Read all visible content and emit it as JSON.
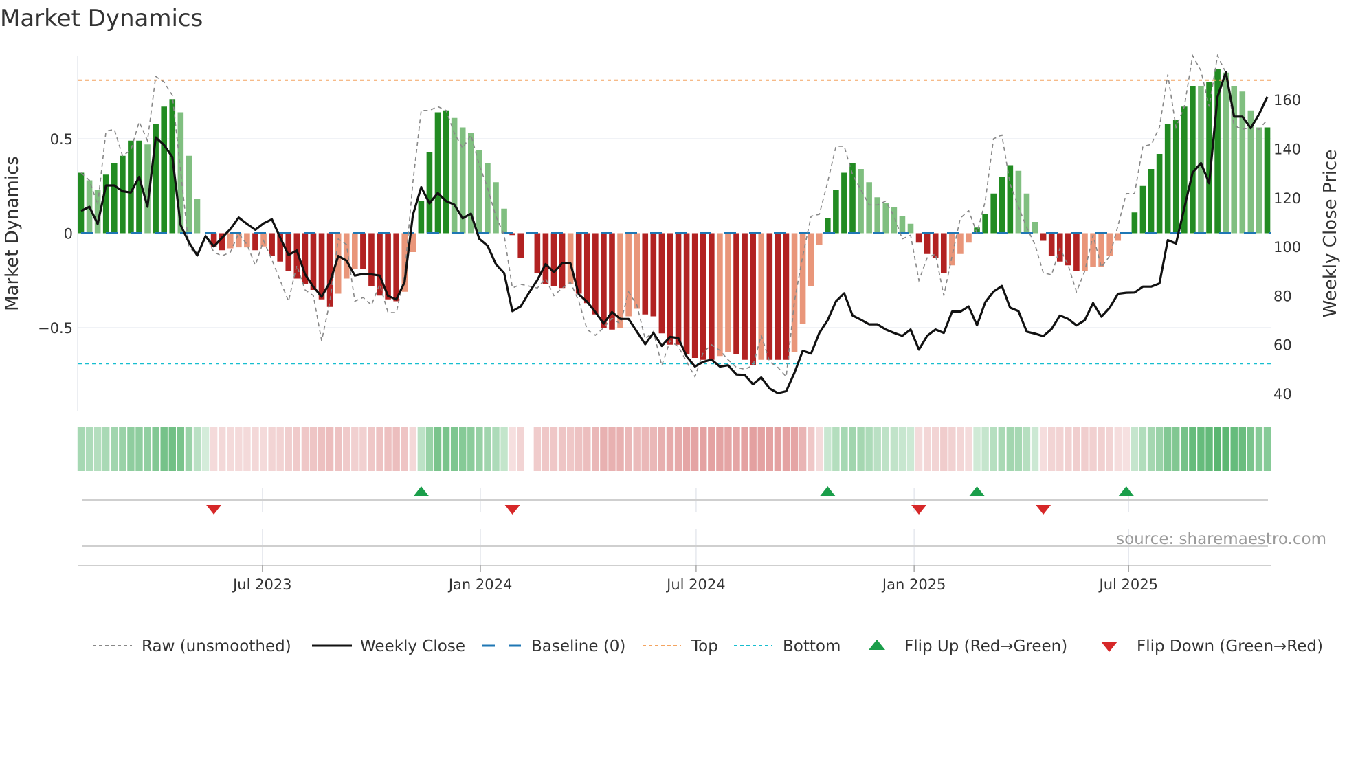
{
  "title": "Market Dynamics",
  "source": "source: sharemaestro.com",
  "chart_data": {
    "type": "bar",
    "title": "Market Dynamics",
    "ylabel": "Market Dynamics",
    "y2label": "Weekly Close Price",
    "x_start": "2023-01-29",
    "x_frequency": "weekly",
    "ylim": [
      -0.94,
      0.94
    ],
    "y2lim": [
      33,
      178
    ],
    "grid": "horizontal",
    "yticks": [
      {
        "value": 0.5,
        "label": "0.5"
      },
      {
        "value": 0,
        "label": "0"
      },
      {
        "value": -0.5,
        "label": "−0.5"
      }
    ],
    "y2ticks": [
      {
        "value": 40,
        "label": "40"
      },
      {
        "value": 60,
        "label": "60"
      },
      {
        "value": 80,
        "label": "80"
      },
      {
        "value": 100,
        "label": "100"
      },
      {
        "value": 120,
        "label": "120"
      },
      {
        "value": 140,
        "label": "140"
      },
      {
        "value": 160,
        "label": "160"
      }
    ],
    "xticks": [
      {
        "date": "2023-07-01",
        "label": "Jul 2023"
      },
      {
        "date": "2024-01-01",
        "label": "Jan 2024"
      },
      {
        "date": "2024-07-01",
        "label": "Jul 2024"
      },
      {
        "date": "2025-01-01",
        "label": "Jan 2025"
      },
      {
        "date": "2025-07-01",
        "label": "Jul 2025"
      }
    ],
    "top": 0.81,
    "bottom": -0.69,
    "baseline": 0,
    "colors": {
      "green_strong": "#228b22",
      "green_weak": "#80bf80",
      "red_strong": "#b22222",
      "red_weak": "#e9967a",
      "raw": "#888888",
      "close": "#111111",
      "baseline": "#1f77b4",
      "top": "#f4a460",
      "bottom": "#17becf",
      "flip_up": "#1a9e4a",
      "flip_down": "#d62728"
    },
    "series": [
      {
        "name": "Market Dynamics",
        "values": [
          0.32,
          0.28,
          0.23,
          0.31,
          0.37,
          0.41,
          0.49,
          0.49,
          0.47,
          0.58,
          0.67,
          0.71,
          0.64,
          0.41,
          0.18,
          0,
          -0.07,
          -0.09,
          -0.08,
          -0.075,
          -0.075,
          -0.09,
          -0.07,
          -0.12,
          -0.15,
          -0.2,
          -0.24,
          -0.27,
          -0.3,
          -0.35,
          -0.39,
          -0.32,
          -0.24,
          -0.19,
          -0.19,
          -0.28,
          -0.33,
          -0.35,
          -0.36,
          -0.31,
          -0.1,
          0.17,
          0.43,
          0.64,
          0.65,
          0.61,
          0.56,
          0.53,
          0.44,
          0.37,
          0.27,
          0.13,
          -0.01,
          -0.13,
          null,
          -0.21,
          -0.27,
          -0.28,
          -0.29,
          -0.27,
          -0.32,
          -0.37,
          -0.43,
          -0.5,
          -0.51,
          -0.5,
          -0.44,
          -0.4,
          -0.43,
          -0.44,
          -0.53,
          -0.59,
          -0.59,
          -0.64,
          -0.66,
          -0.67,
          -0.67,
          -0.65,
          -0.63,
          -0.64,
          -0.67,
          -0.7,
          -0.67,
          -0.67,
          -0.67,
          -0.67,
          -0.63,
          -0.48,
          -0.28,
          -0.06,
          0.08,
          0.23,
          0.32,
          0.37,
          0.34,
          0.27,
          0.19,
          0.16,
          0.14,
          0.09,
          0.05,
          -0.05,
          -0.11,
          -0.13,
          -0.21,
          -0.17,
          -0.11,
          -0.05,
          0.03,
          0.1,
          0.21,
          0.3,
          0.36,
          0.33,
          0.21,
          0.06,
          -0.04,
          -0.12,
          -0.15,
          -0.17,
          -0.2,
          -0.2,
          -0.18,
          -0.18,
          -0.12,
          -0.04,
          0,
          0.11,
          0.25,
          0.34,
          0.42,
          0.58,
          0.6,
          0.67,
          0.78,
          0.78,
          0.8,
          0.87,
          0.85,
          0.78,
          0.75,
          0.65,
          0.56,
          0.56
        ],
        "strengthening": [
          1,
          0,
          0,
          1,
          1,
          1,
          1,
          1,
          0,
          1,
          1,
          1,
          0,
          0,
          0,
          0,
          1,
          1,
          0,
          0,
          0,
          1,
          0,
          1,
          1,
          1,
          1,
          1,
          1,
          1,
          1,
          0,
          0,
          0,
          1,
          1,
          1,
          1,
          1,
          0,
          0,
          1,
          1,
          1,
          1,
          0,
          0,
          0,
          0,
          0,
          0,
          0,
          1,
          1,
          0,
          1,
          1,
          1,
          1,
          0,
          1,
          1,
          1,
          1,
          1,
          0,
          0,
          0,
          1,
          1,
          1,
          1,
          1,
          1,
          1,
          1,
          1,
          0,
          0,
          1,
          1,
          1,
          0,
          1,
          1,
          1,
          0,
          0,
          0,
          0,
          1,
          1,
          1,
          1,
          0,
          0,
          0,
          0,
          0,
          0,
          0,
          1,
          1,
          1,
          1,
          0,
          0,
          0,
          1,
          1,
          1,
          1,
          1,
          0,
          0,
          0,
          1,
          1,
          1,
          1,
          1,
          0,
          0,
          0,
          0,
          0,
          0,
          1,
          1,
          1,
          1,
          1,
          1,
          1,
          1,
          0,
          1,
          1,
          0,
          0,
          0,
          0,
          0,
          1
        ]
      },
      {
        "name": "Raw (unsmoothed)",
        "values": [
          0.32,
          0.28,
          0.15,
          0.54,
          0.55,
          0.41,
          0.44,
          0.59,
          0.49,
          0.83,
          0.8,
          0.73,
          0.33,
          -0.07,
          -0.12,
          -0.01,
          -0.1,
          -0.12,
          -0.1,
          0,
          -0.06,
          -0.17,
          -0.04,
          -0.14,
          -0.25,
          -0.36,
          -0.17,
          -0.3,
          -0.33,
          -0.57,
          -0.36,
          -0.03,
          -0.06,
          -0.36,
          -0.34,
          -0.38,
          -0.27,
          -0.42,
          -0.42,
          -0.22,
          0.27,
          0.65,
          0.65,
          0.67,
          0.65,
          0.53,
          0.45,
          0.52,
          0.36,
          0.24,
          0.09,
          -0.01,
          -0.29,
          -0.27,
          -0.28,
          -0.29,
          -0.24,
          -0.33,
          -0.29,
          -0.26,
          -0.36,
          -0.51,
          -0.54,
          -0.5,
          -0.45,
          -0.48,
          -0.31,
          -0.38,
          -0.56,
          -0.52,
          -0.7,
          -0.57,
          -0.6,
          -0.68,
          -0.76,
          -0.63,
          -0.59,
          -0.62,
          -0.67,
          -0.71,
          -0.72,
          -0.7,
          -0.54,
          -0.68,
          -0.71,
          -0.76,
          -0.36,
          -0.12,
          0.09,
          0.1,
          0.27,
          0.46,
          0.46,
          0.31,
          0.23,
          0.15,
          0.15,
          0.17,
          0.09,
          -0.03,
          -0.01,
          -0.25,
          -0.13,
          -0.11,
          -0.33,
          -0.12,
          0.08,
          0.12,
          0,
          0.17,
          0.5,
          0.52,
          0.26,
          0.14,
          0.03,
          -0.06,
          -0.21,
          -0.22,
          -0.08,
          -0.17,
          -0.31,
          -0.2,
          -0.01,
          -0.18,
          -0.12,
          0.04,
          0.21,
          0.21,
          0.46,
          0.47,
          0.56,
          0.84,
          0.56,
          0.67,
          0.94,
          0.86,
          0.67,
          0.94,
          0.85,
          0.57,
          0.55,
          0.56,
          0.55,
          0.6
        ]
      },
      {
        "name": "Weekly Close",
        "axis": "right",
        "values": [
          114.6,
          116.3,
          109.3,
          125,
          125,
          122.6,
          122.1,
          128.5,
          116.3,
          144.6,
          141.5,
          136.6,
          108.8,
          101.8,
          96.4,
          104.3,
          100.1,
          103.7,
          107.2,
          111.9,
          109.3,
          106.9,
          109.5,
          111.2,
          103.7,
          96.6,
          98.5,
          88.7,
          83.6,
          79.6,
          85.5,
          96.2,
          94.3,
          88.2,
          88.9,
          88.7,
          88.2,
          79.9,
          78.5,
          85.5,
          113,
          124.3,
          117.7,
          121.9,
          118.6,
          117.2,
          111.6,
          113.5,
          103.2,
          100.4,
          92.9,
          89.2,
          73.7,
          75.6,
          81.2,
          86.4,
          92.9,
          89.6,
          93.3,
          93.2,
          80.5,
          77.5,
          73.3,
          68.6,
          73.3,
          70.5,
          70.5,
          65.3,
          60.2,
          64.8,
          59.5,
          63.2,
          62.7,
          55.2,
          51.1,
          53,
          53.9,
          51.1,
          51.6,
          47.8,
          47.6,
          43.8,
          46.6,
          42.1,
          40.2,
          41,
          48.5,
          57.5,
          56.4,
          64.8,
          70,
          77.7,
          81,
          71.9,
          70.2,
          68.3,
          68.3,
          66.2,
          64.8,
          63.6,
          66.2,
          58,
          63.6,
          66.2,
          64.8,
          73.5,
          73.5,
          75.6,
          67.9,
          77.3,
          81.7,
          84,
          75.1,
          73.7,
          65.3,
          64.5,
          63.5,
          66.4,
          71.9,
          70.5,
          67.9,
          70,
          77,
          71.4,
          75.1,
          80.8,
          81.2,
          81.3,
          83.7,
          83.7,
          85,
          102.7,
          101.3,
          115.8,
          130.3,
          134.1,
          125.9,
          161.2,
          171.2,
          153.1,
          153.1,
          148.4,
          154,
          161.2
        ]
      }
    ],
    "flip_up": [
      "2023-11-12",
      "2024-10-20",
      "2025-02-23",
      "2025-06-29"
    ],
    "flip_down": [
      "2023-05-21",
      "2024-01-28",
      "2025-01-05",
      "2025-04-20"
    ],
    "legend_position": "bottom",
    "legend": {
      "raw": "Raw (unsmoothed)",
      "close": "Weekly Close",
      "baseline": "Baseline (0)",
      "top": "Top",
      "bottom": "Bottom",
      "flip_up": "Flip Up (Red→Green)",
      "flip_down": "Flip Down (Green→Red)"
    }
  }
}
